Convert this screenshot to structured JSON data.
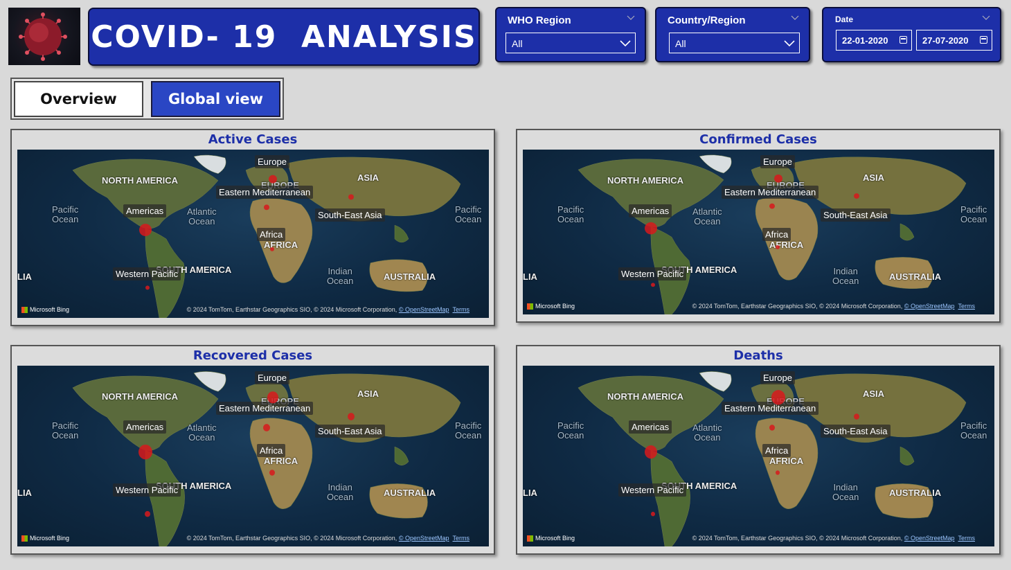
{
  "header": {
    "title": "COVID- 19  ANALYSIS",
    "logo_icon": "coronavirus-icon"
  },
  "filters": {
    "who_region": {
      "label": "WHO Region",
      "value": "All"
    },
    "country_region": {
      "label": "Country/Region",
      "value": "All"
    },
    "date": {
      "label": "Date",
      "start": "22-01-2020",
      "end": "27-07-2020"
    }
  },
  "nav": {
    "overview_label": "Overview",
    "global_label": "Global view"
  },
  "map_labels": {
    "continents": [
      "NORTH AMERICA",
      "EUROPE",
      "ASIA",
      "AFRICA",
      "SOUTH AMERICA",
      "AUSTRALIA",
      "LIA"
    ],
    "oceans": [
      "Pacific\nOcean",
      "Atlantic\nOcean",
      "Indian\nOcean",
      "Pacific\nOcean"
    ],
    "regions": [
      "Europe",
      "Eastern Mediterranean",
      "Americas",
      "South-East Asia",
      "Africa",
      "Western Pacific"
    ],
    "attribution_left": "Microsoft Bing",
    "attribution_right": "© 2024 TomTom, Earthstar Geographics SIO, © 2024 Microsoft Corporation,",
    "osm": "© OpenStreetMap",
    "terms": "Terms"
  },
  "maps": [
    {
      "title": "Active Cases"
    },
    {
      "title": "Confirmed Cases"
    },
    {
      "title": "Recovered Cases"
    },
    {
      "title": "Deaths"
    }
  ],
  "colors": {
    "accent": "#1d2fa8",
    "bubble": "#d7191c"
  }
}
